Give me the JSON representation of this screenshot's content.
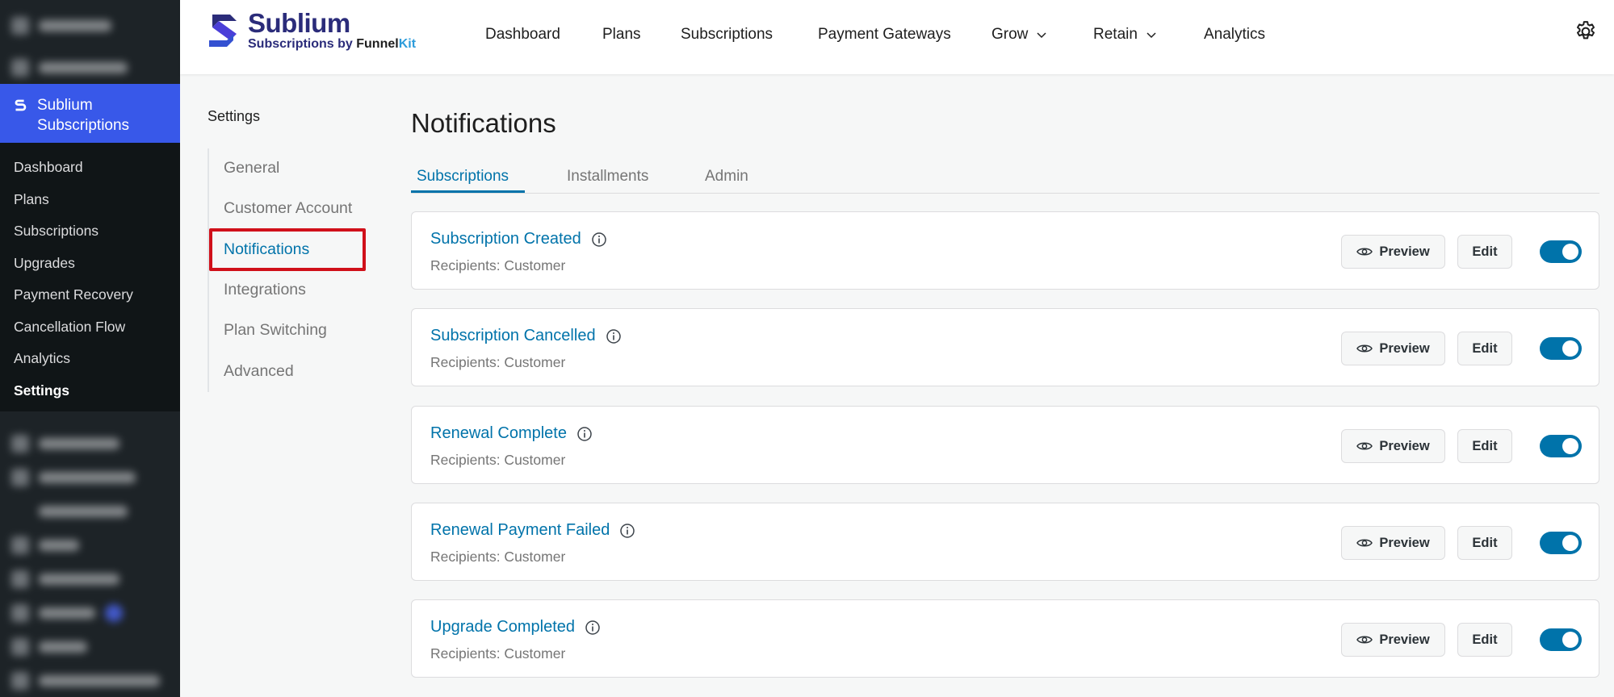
{
  "wp_menu": {
    "plugin_label": "Sublium Subscriptions",
    "submenu": [
      {
        "label": "Dashboard",
        "current": false
      },
      {
        "label": "Plans",
        "current": false
      },
      {
        "label": "Subscriptions",
        "current": false
      },
      {
        "label": "Upgrades",
        "current": false
      },
      {
        "label": "Payment Recovery",
        "current": false
      },
      {
        "label": "Cancellation Flow",
        "current": false
      },
      {
        "label": "Analytics",
        "current": false
      },
      {
        "label": "Settings",
        "current": true
      }
    ]
  },
  "brand": {
    "name": "Sublium",
    "sub_prefix": "Subscriptions by ",
    "sub_funnel": "Funnel",
    "sub_kit": "Kit",
    "colors": {
      "primary": "#2b2c7a",
      "accent": "#2d9cdb"
    }
  },
  "topnav": {
    "items": [
      {
        "label": "Dashboard",
        "dropdown": false
      },
      {
        "label": "Plans",
        "dropdown": false
      },
      {
        "label": "Subscriptions",
        "dropdown": false
      },
      {
        "label": "Payment Gateways",
        "dropdown": false
      },
      {
        "label": "Grow",
        "dropdown": true
      },
      {
        "label": "Retain",
        "dropdown": true
      },
      {
        "label": "Analytics",
        "dropdown": false
      }
    ],
    "settings_icon": "gear-icon"
  },
  "settings": {
    "title": "Settings",
    "items": [
      {
        "label": "General",
        "active": false
      },
      {
        "label": "Customer Account",
        "active": false
      },
      {
        "label": "Notifications",
        "active": true
      },
      {
        "label": "Integrations",
        "active": false
      },
      {
        "label": "Plan Switching",
        "active": false
      },
      {
        "label": "Advanced",
        "active": false
      }
    ],
    "highlight_color": "#d0101a"
  },
  "main": {
    "title": "Notifications",
    "tabs": [
      {
        "label": "Subscriptions",
        "active": true
      },
      {
        "label": "Installments",
        "active": false
      },
      {
        "label": "Admin",
        "active": false
      }
    ],
    "preview_label": "Preview",
    "edit_label": "Edit",
    "accent_color": "#0073aa",
    "notifications": [
      {
        "title": "Subscription Created",
        "recipients": "Recipients: Customer",
        "enabled": true
      },
      {
        "title": "Subscription Cancelled",
        "recipients": "Recipients: Customer",
        "enabled": true
      },
      {
        "title": "Renewal Complete",
        "recipients": "Recipients: Customer",
        "enabled": true
      },
      {
        "title": "Renewal Payment Failed",
        "recipients": "Recipients: Customer",
        "enabled": true
      },
      {
        "title": "Upgrade Completed",
        "recipients": "Recipients: Customer",
        "enabled": true
      }
    ]
  }
}
